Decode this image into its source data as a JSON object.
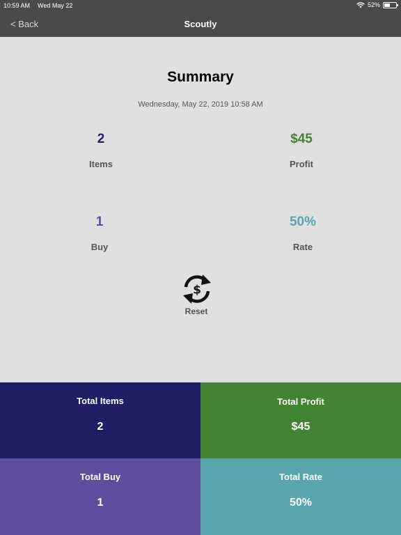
{
  "status_bar": {
    "time": "10:59 AM",
    "date": "Wed May 22",
    "battery": "52%",
    "battery_level": 0.52
  },
  "nav": {
    "back_label": "< Back",
    "title": "Scoutly"
  },
  "summary": {
    "title": "Summary",
    "datetime": "Wednesday, May 22, 2019 10:58 AM",
    "items": {
      "value": "2",
      "label": "Items"
    },
    "profit": {
      "value": "$45",
      "label": "Profit"
    },
    "buy": {
      "value": "1",
      "label": "Buy"
    },
    "rate": {
      "value": "50%",
      "label": "Rate"
    },
    "reset_label": "Reset"
  },
  "totals": {
    "items": {
      "label": "Total Items",
      "value": "2"
    },
    "profit": {
      "label": "Total Profit",
      "value": "$45"
    },
    "buy": {
      "label": "Total Buy",
      "value": "1"
    },
    "rate": {
      "label": "Total Rate",
      "value": "50%"
    }
  },
  "colors": {
    "items": "#1f1f66",
    "profit": "#438334",
    "buy": "#5e4d9c",
    "rate": "#58a6ac",
    "nav_background": "#4a4a4a",
    "page_background": "#e0e0e0"
  }
}
